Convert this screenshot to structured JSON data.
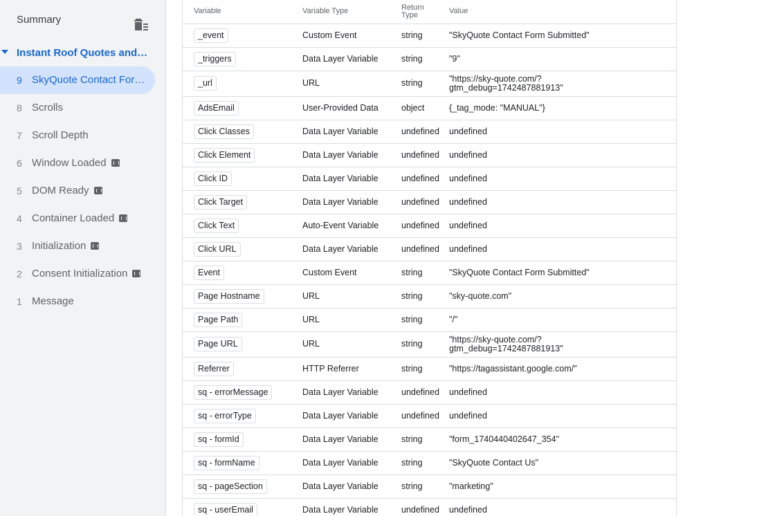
{
  "sidebar": {
    "summary_label": "Summary",
    "container_label": "Instant Roof Quotes and W...",
    "events": [
      {
        "num": "9",
        "label": "SkyQuote Contact Form...",
        "selected": true,
        "code": false
      },
      {
        "num": "8",
        "label": "Scrolls",
        "code": false
      },
      {
        "num": "7",
        "label": "Scroll Depth",
        "code": false
      },
      {
        "num": "6",
        "label": "Window Loaded",
        "code": true
      },
      {
        "num": "5",
        "label": "DOM Ready",
        "code": true
      },
      {
        "num": "4",
        "label": "Container Loaded",
        "code": true
      },
      {
        "num": "3",
        "label": "Initialization",
        "code": true
      },
      {
        "num": "2",
        "label": "Consent Initialization",
        "code": true
      },
      {
        "num": "1",
        "label": "Message",
        "code": false
      }
    ]
  },
  "table": {
    "headers": {
      "variable": "Variable",
      "variable_type": "Variable Type",
      "return_type": "Return\nType",
      "value": "Value"
    },
    "rows": [
      {
        "variable": "_event",
        "type": "Custom Event",
        "return": "string",
        "value": "\"SkyQuote Contact Form Submitted\""
      },
      {
        "variable": "_triggers",
        "type": "Data Layer Variable",
        "return": "string",
        "value": "\"9\""
      },
      {
        "variable": "_url",
        "type": "URL",
        "return": "string",
        "value": "\"https://sky-quote.com/?\ngtm_debug=1742487881913\"",
        "tall": true
      },
      {
        "variable": "AdsEmail",
        "type": "User-Provided Data",
        "return": "object",
        "value": "{_tag_mode: \"MANUAL\"}"
      },
      {
        "variable": "Click Classes",
        "type": "Data Layer Variable",
        "return": "undefined",
        "value": "undefined"
      },
      {
        "variable": "Click Element",
        "type": "Data Layer Variable",
        "return": "undefined",
        "value": "undefined"
      },
      {
        "variable": "Click ID",
        "type": "Data Layer Variable",
        "return": "undefined",
        "value": "undefined"
      },
      {
        "variable": "Click Target",
        "type": "Data Layer Variable",
        "return": "undefined",
        "value": "undefined"
      },
      {
        "variable": "Click Text",
        "type": "Auto-Event Variable",
        "return": "undefined",
        "value": "undefined"
      },
      {
        "variable": "Click URL",
        "type": "Data Layer Variable",
        "return": "undefined",
        "value": "undefined"
      },
      {
        "variable": "Event",
        "type": "Custom Event",
        "return": "string",
        "value": "\"SkyQuote Contact Form Submitted\""
      },
      {
        "variable": "Page Hostname",
        "type": "URL",
        "return": "string",
        "value": "\"sky-quote.com\""
      },
      {
        "variable": "Page Path",
        "type": "URL",
        "return": "string",
        "value": "\"/\""
      },
      {
        "variable": "Page URL",
        "type": "URL",
        "return": "string",
        "value": "\"https://sky-quote.com/?\ngtm_debug=1742487881913\"",
        "tall": true
      },
      {
        "variable": "Referrer",
        "type": "HTTP Referrer",
        "return": "string",
        "value": "\"https://tagassistant.google.com/\""
      },
      {
        "variable": "sq - errorMessage",
        "type": "Data Layer Variable",
        "return": "undefined",
        "value": "undefined"
      },
      {
        "variable": "sq - errorType",
        "type": "Data Layer Variable",
        "return": "undefined",
        "value": "undefined"
      },
      {
        "variable": "sq - formId",
        "type": "Data Layer Variable",
        "return": "string",
        "value": "\"form_1740440402647_354\""
      },
      {
        "variable": "sq - formName",
        "type": "Data Layer Variable",
        "return": "string",
        "value": "\"SkyQuote Contact Us\""
      },
      {
        "variable": "sq - pageSection",
        "type": "Data Layer Variable",
        "return": "string",
        "value": "\"marketing\""
      },
      {
        "variable": "sq - userEmail",
        "type": "Data Layer Variable",
        "return": "undefined",
        "value": "undefined"
      }
    ]
  }
}
